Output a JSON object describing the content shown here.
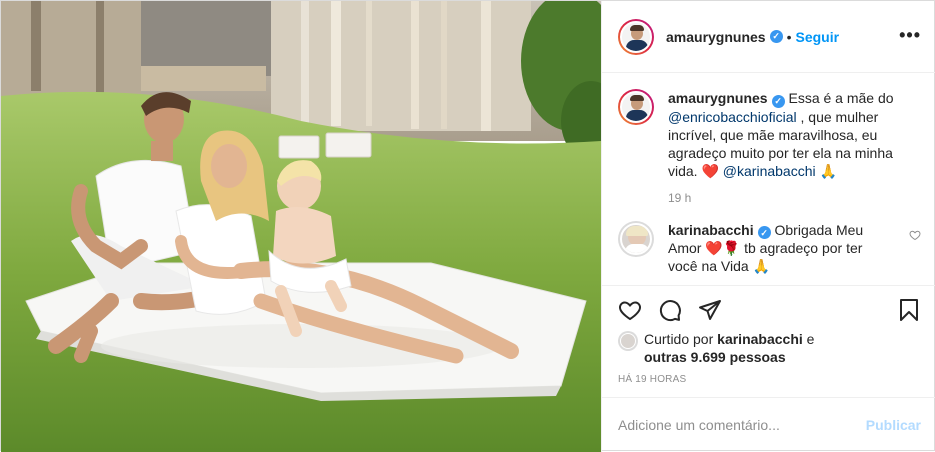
{
  "post": {
    "author": "amaurygnunes",
    "verified_mark": "✓",
    "dot": "•",
    "follow_label": "Seguir",
    "more_label": "•••"
  },
  "caption": {
    "username": "amaurygnunes",
    "text_before": "Essa é a mãe do",
    "mention1": "@enricobacchioficial",
    "text_after": ", que mulher incrível, que mãe maravilhosa, eu agradeço muito por ter ela na minha vida.",
    "heart": "❤️",
    "mention2": "@karinabacchi",
    "hands": "🙏",
    "time": "19 h"
  },
  "reply": {
    "username": "karinabacchi",
    "text": "Obrigada Meu Amor",
    "emojis": "❤️🌹",
    "text2": "tb agradeço por ter você na Vida",
    "hands": "🙏"
  },
  "likes": {
    "prefix": "Curtido por",
    "user": "karinabacchi",
    "suffix": "e",
    "others": "outras 9.699 pessoas"
  },
  "posted_ago": "HÁ 19 HORAS",
  "comment_box": {
    "placeholder": "Adicione um comentário...",
    "publish_label": "Publicar"
  },
  "colors": {
    "link": "#0095f6",
    "mention": "#00376b",
    "publish_disabled": "#b3dbff",
    "like_heart": "#ed4956"
  },
  "icons": {
    "like": "heart-icon",
    "comment": "comment-icon",
    "share": "share-icon",
    "save": "bookmark-icon",
    "more": "more-icon"
  }
}
